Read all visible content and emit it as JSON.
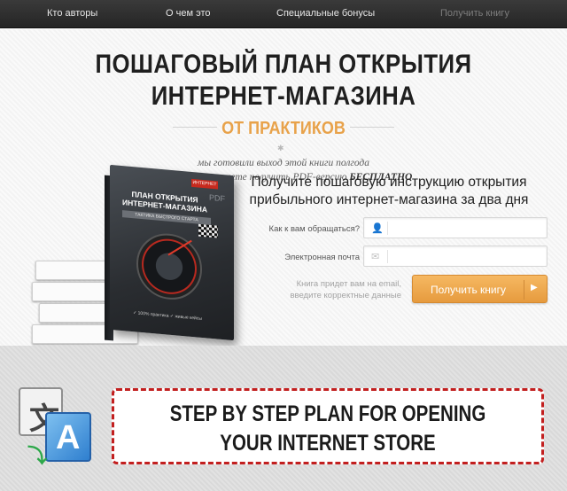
{
  "nav": {
    "items": [
      "Кто авторы",
      "О чем это",
      "Специальные бонусы",
      "Получить книгу"
    ]
  },
  "hero": {
    "title_line1": "ПОШАГОВЫЙ ПЛАН ОТКРЫТИЯ",
    "title_line2": "ИНТЕРНЕТ-МАГАЗИНА",
    "subtitle": "ОТ ПРАКТИКОВ",
    "intro_line1": "мы готовили выход этой книги полгода",
    "intro_line2_prefix": "и теперь вы можете получить PDF-версию ",
    "intro_line2_emphasis": "БЕСПЛАТНО"
  },
  "book": {
    "badge": "ИНТЕРНЕТ",
    "format": "PDF",
    "title": "ПЛАН ОТКРЫТИЯ ИНТЕРНЕТ-МАГАЗИНА",
    "tagline": "ТАКТИКА БЫСТРОГО СТАРТА",
    "footer": "✓ 100% практика   ✓ живые кейсы"
  },
  "form": {
    "title_line1": "Получите пошаговую инструкцию открытия",
    "title_line2": "прибыльного интернет-магазина за два дня",
    "name_label": "Как к вам обращаться?",
    "email_label": "Электронная почта",
    "name_value": "",
    "email_value": "",
    "note_line1": "Книга придет вам на email,",
    "note_line2": "введите корректные данные",
    "submit_label": "Получить книгу",
    "accent_color": "#e9a24a"
  },
  "translation": {
    "line1": "STEP BY STEP PLAN FOR OPENING",
    "line2": "YOUR INTERNET STORE",
    "border_color": "#c21f1f"
  }
}
